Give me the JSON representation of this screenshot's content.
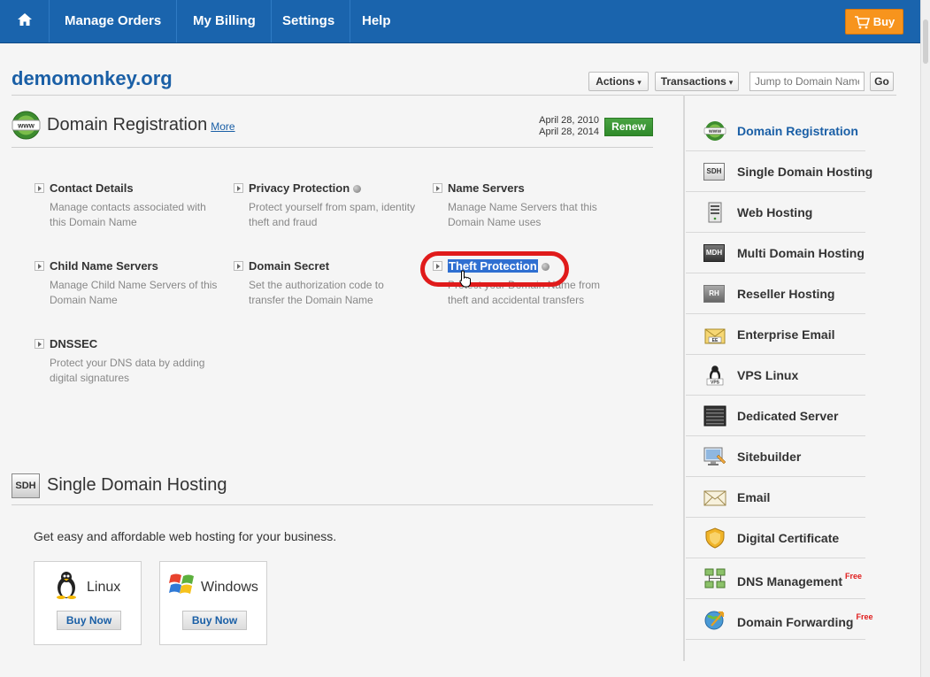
{
  "nav": {
    "items": [
      "Manage Orders",
      "My Billing",
      "Settings",
      "Help"
    ],
    "buy_label": "Buy"
  },
  "header": {
    "domain": "demomonkey.org",
    "actions_label": "Actions",
    "transactions_label": "Transactions",
    "jump_placeholder": "Jump to Domain Name",
    "go_label": "Go"
  },
  "registration": {
    "title": "Domain Registration",
    "more_label": "More",
    "date_start": "April 28, 2010",
    "date_end": "April 28, 2014",
    "renew_label": "Renew",
    "features": [
      {
        "title": "Contact Details",
        "desc": "Manage contacts associated with this Domain Name"
      },
      {
        "title": "Privacy Protection",
        "desc": "Protect yourself from spam, identity theft and fraud"
      },
      {
        "title": "Name Servers",
        "desc": "Manage Name Servers that this Domain Name uses"
      },
      {
        "title": "Child Name Servers",
        "desc": "Manage Child Name Servers of this Domain Name"
      },
      {
        "title": "Domain Secret",
        "desc": "Set the authorization code to transfer the Domain Name"
      },
      {
        "title": "Theft Protection",
        "desc": "Protect your Domain Name from theft and accidental transfers"
      },
      {
        "title": "DNSSEC",
        "desc": "Protect your DNS data by adding digital signatures"
      }
    ]
  },
  "hosting": {
    "icon_text": "SDH",
    "title": "Single Domain Hosting",
    "description": "Get easy and affordable web hosting for your business.",
    "options": [
      {
        "label": "Linux",
        "button": "Buy Now"
      },
      {
        "label": "Windows",
        "button": "Buy Now"
      }
    ]
  },
  "sidebar": {
    "items": [
      {
        "label": "Domain Registration",
        "icon": "www-globe-icon",
        "active": true
      },
      {
        "label": "Single Domain Hosting",
        "icon": "sdh-icon",
        "icon_text": "SDH"
      },
      {
        "label": "Web Hosting",
        "icon": "server-icon"
      },
      {
        "label": "Multi Domain Hosting",
        "icon": "mdh-icon",
        "icon_text": "MDH"
      },
      {
        "label": "Reseller Hosting",
        "icon": "rh-icon",
        "icon_text": "RH"
      },
      {
        "label": "Enterprise Email",
        "icon": "enterprise-email-icon",
        "icon_text": "EE"
      },
      {
        "label": "VPS Linux",
        "icon": "vps-linux-icon",
        "icon_text": "VPS"
      },
      {
        "label": "Dedicated Server",
        "icon": "dedicated-server-icon"
      },
      {
        "label": "Sitebuilder",
        "icon": "sitebuilder-icon"
      },
      {
        "label": "Email",
        "icon": "email-icon"
      },
      {
        "label": "Digital Certificate",
        "icon": "certificate-shield-icon"
      },
      {
        "label": "DNS Management",
        "icon": "dns-icon",
        "badge": "Free"
      },
      {
        "label": "Domain Forwarding",
        "icon": "forwarding-globe-icon",
        "badge": "Free"
      }
    ]
  },
  "colors": {
    "nav_blue": "#1a64ad",
    "link_blue": "#1a5fa6",
    "buy_orange": "#f7941d",
    "renew_green": "#3a9434",
    "highlight_red": "#e01b1b"
  }
}
